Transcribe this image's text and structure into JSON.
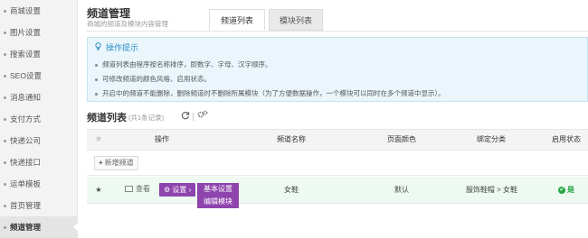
{
  "sidebar": {
    "items": [
      {
        "label": "商城设置"
      },
      {
        "label": "图片设置"
      },
      {
        "label": "搜索设置"
      },
      {
        "label": "SEO设置"
      },
      {
        "label": "消息通知"
      },
      {
        "label": "支付方式"
      },
      {
        "label": "快递公司"
      },
      {
        "label": "快递接口"
      },
      {
        "label": "运单模板"
      },
      {
        "label": "首页管理"
      },
      {
        "label": "频道管理"
      }
    ],
    "active_index": 10
  },
  "header": {
    "title": "频道管理",
    "subtitle": "商城的频道及模块内容管理",
    "tabs": [
      {
        "label": "频道列表"
      },
      {
        "label": "模块列表"
      }
    ]
  },
  "tips": {
    "title": "操作提示",
    "items": [
      "频道列表由程序按名称排序，即数字、字母、汉字顺序。",
      "可修改频道的颜色风格、启用状态。",
      "开启中的频道不能删除，删除频道时不删除所属模块（为了方便数据操作，一个模块可以同时在多个频道中显示）。"
    ]
  },
  "list": {
    "title": "频道列表",
    "count_text": "(共1条记录)",
    "add_label": "新增频道",
    "columns": [
      "操作",
      "频道名称",
      "页面颜色",
      "绑定分类",
      "启用状态"
    ],
    "rows": [
      {
        "view_label": "查看",
        "settings_label": "设置",
        "name": "女鞋",
        "color": "默认",
        "category": "服饰鞋帽 > 女鞋",
        "status": "是"
      }
    ],
    "settings_menu": [
      "基本设置",
      "编辑模块"
    ]
  },
  "colors": {
    "accent_purple": "#8e44ad",
    "tip_blue": "#2b8fc6",
    "status_green": "#27a844"
  }
}
